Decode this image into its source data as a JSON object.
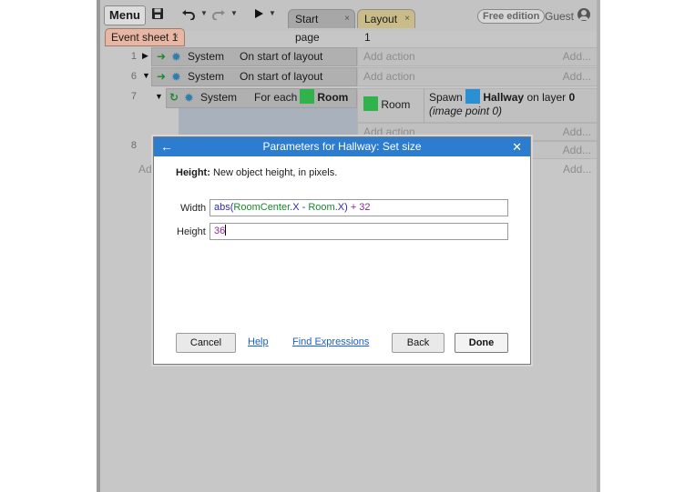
{
  "toolbar": {
    "menu_label": "Menu",
    "save_icon": "save-icon",
    "undo_icon": "undo-icon",
    "redo_icon": "redo-icon",
    "play_icon": "play-icon",
    "free_edition": "Free edition",
    "guest": "Guest"
  },
  "tabs": {
    "start_page": "Start page",
    "layout_1": "Layout 1",
    "event_sheet_1": "Event sheet 1",
    "close_glyph": "×"
  },
  "events": {
    "row1": {
      "line": "1",
      "object": "System",
      "condition": "On start of layout",
      "add_action": "Add action",
      "add_dots": "Add..."
    },
    "row6": {
      "line": "6",
      "object": "System",
      "condition": "On start of layout",
      "add_action": "Add action",
      "add_dots": "Add..."
    },
    "row7": {
      "line": "7",
      "object": "System",
      "condition_prefix": "For each",
      "condition_object": "Room",
      "action_object": "Room",
      "action_prefix": "Spawn",
      "action_target": "Hallway",
      "action_suffix": "on layer",
      "action_layer": "0",
      "action_note": "(image point 0)",
      "add_action": "Add action",
      "add_dots": "Add..."
    },
    "row8": {
      "line": "8",
      "add_left": "Ad",
      "add_dots": "Add..."
    }
  },
  "dialog": {
    "title": "Parameters for Hallway: Set size",
    "help_param": "Height:",
    "help_desc": "New object height, in pixels.",
    "width_label": "Width",
    "width_value": {
      "fn": "abs(",
      "obj1": "RoomCenter",
      "dot1": ".X - ",
      "obj2": "Room",
      "dot2": ".X) ",
      "plus": "+ 32"
    },
    "height_label": "Height",
    "height_value": "36",
    "cancel": "Cancel",
    "help": "Help",
    "find_expressions": "Find Expressions",
    "back": "Back",
    "done": "Done"
  }
}
